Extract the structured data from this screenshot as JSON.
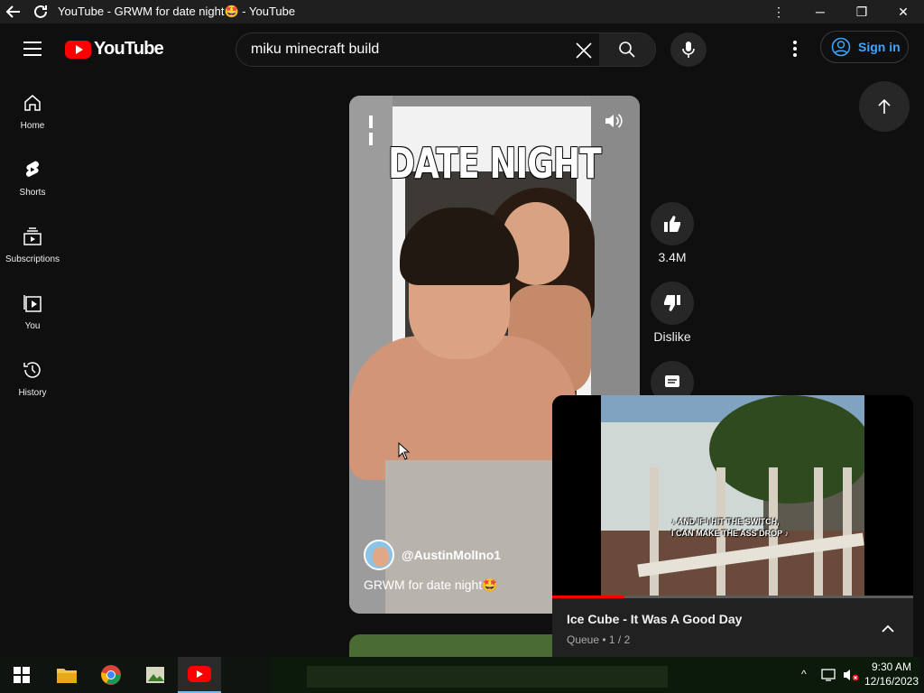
{
  "window": {
    "title": "YouTube - GRWM for date night🤩 - YouTube",
    "back_icon": "back-arrow-icon",
    "reload_icon": "reload-icon"
  },
  "masthead": {
    "logo_text": "YouTube",
    "search_value": "miku minecraft build",
    "sign_in_label": "Sign in"
  },
  "sidebar": {
    "items": [
      {
        "label": "Home",
        "icon": "home-icon"
      },
      {
        "label": "Shorts",
        "icon": "shorts-icon"
      },
      {
        "label": "Subscriptions",
        "icon": "subscriptions-icon"
      },
      {
        "label": "You",
        "icon": "you-icon"
      },
      {
        "label": "History",
        "icon": "history-icon"
      }
    ]
  },
  "short": {
    "overlay_text": "DATE NIGHT",
    "channel": "@AustinMolIno1",
    "title": "GRWM for date night🤩",
    "like_count": "3.4M",
    "dislike_label": "Dislike"
  },
  "miniplayer": {
    "title": "Ice Cube - It Was A Good Day",
    "subtitle": "Queue • 1 / 2",
    "lyrics_line1": "♪ AND IF I HIT THE SWITCH,",
    "lyrics_line2": "I CAN MAKE THE ASS DROP ♪",
    "progress_fraction": 0.2
  },
  "taskbar": {
    "time": "9:30 AM",
    "date": "12/16/2023"
  },
  "colors": {
    "accent_red": "#ff0000",
    "link_blue": "#3ea6ff",
    "background": "#0f0f0f"
  }
}
